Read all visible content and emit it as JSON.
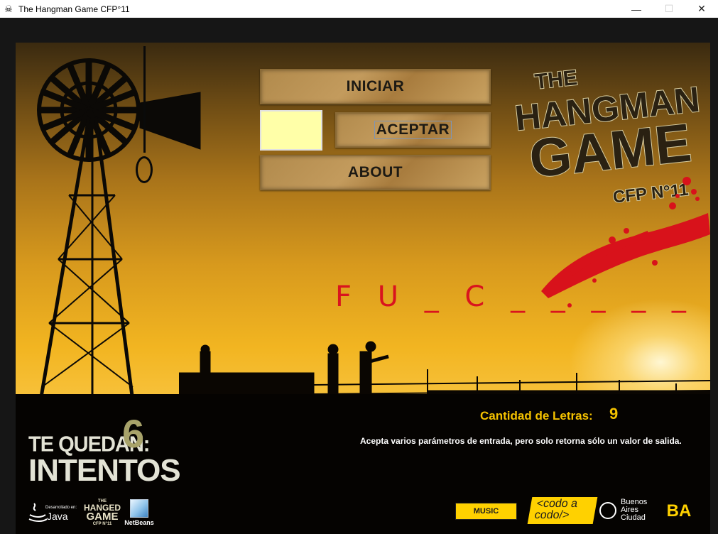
{
  "window": {
    "title": "The Hangman Game CFP°11",
    "icon": "skull-icon",
    "controls": {
      "minimize": "—",
      "maximize": "☐",
      "close": "✕"
    }
  },
  "menu": {
    "iniciar_label": "INICIAR",
    "aceptar_label": "ACEPTAR",
    "about_label": "ABOUT",
    "letter_input_value": ""
  },
  "logo": {
    "line1": "THE",
    "line2": "HANGMAN",
    "line3": "GAME",
    "line4": "CFP N°11"
  },
  "game": {
    "word_display": "F U _ C _ _ _ _ _",
    "count_label": "Cantidad de Letras:",
    "count_value": "9",
    "hint": "Acepta varios parámetros de entrada, pero solo retorna sólo un valor de salida.",
    "tries_label": "TE QUEDAN:",
    "tries_value": "6",
    "tries_word": "INTENTOS"
  },
  "footer": {
    "java_small": "Desarrollado en:",
    "java_text": "Java",
    "hangman_mini": [
      "THE",
      "HANGED",
      "GAME",
      "CFP N°11"
    ],
    "netbeans_label": "NetBeans",
    "music_label": "MUSIC",
    "codo_line1": "<codo a",
    "codo_line2": "codo/>",
    "ba_city_lines": [
      "Buenos",
      "Aires",
      "Ciudad"
    ],
    "ba_mark": "BA"
  },
  "colors": {
    "accent_yellow": "#f4c200",
    "word_red": "#d9141e",
    "button_tan": "#c39b5d"
  }
}
